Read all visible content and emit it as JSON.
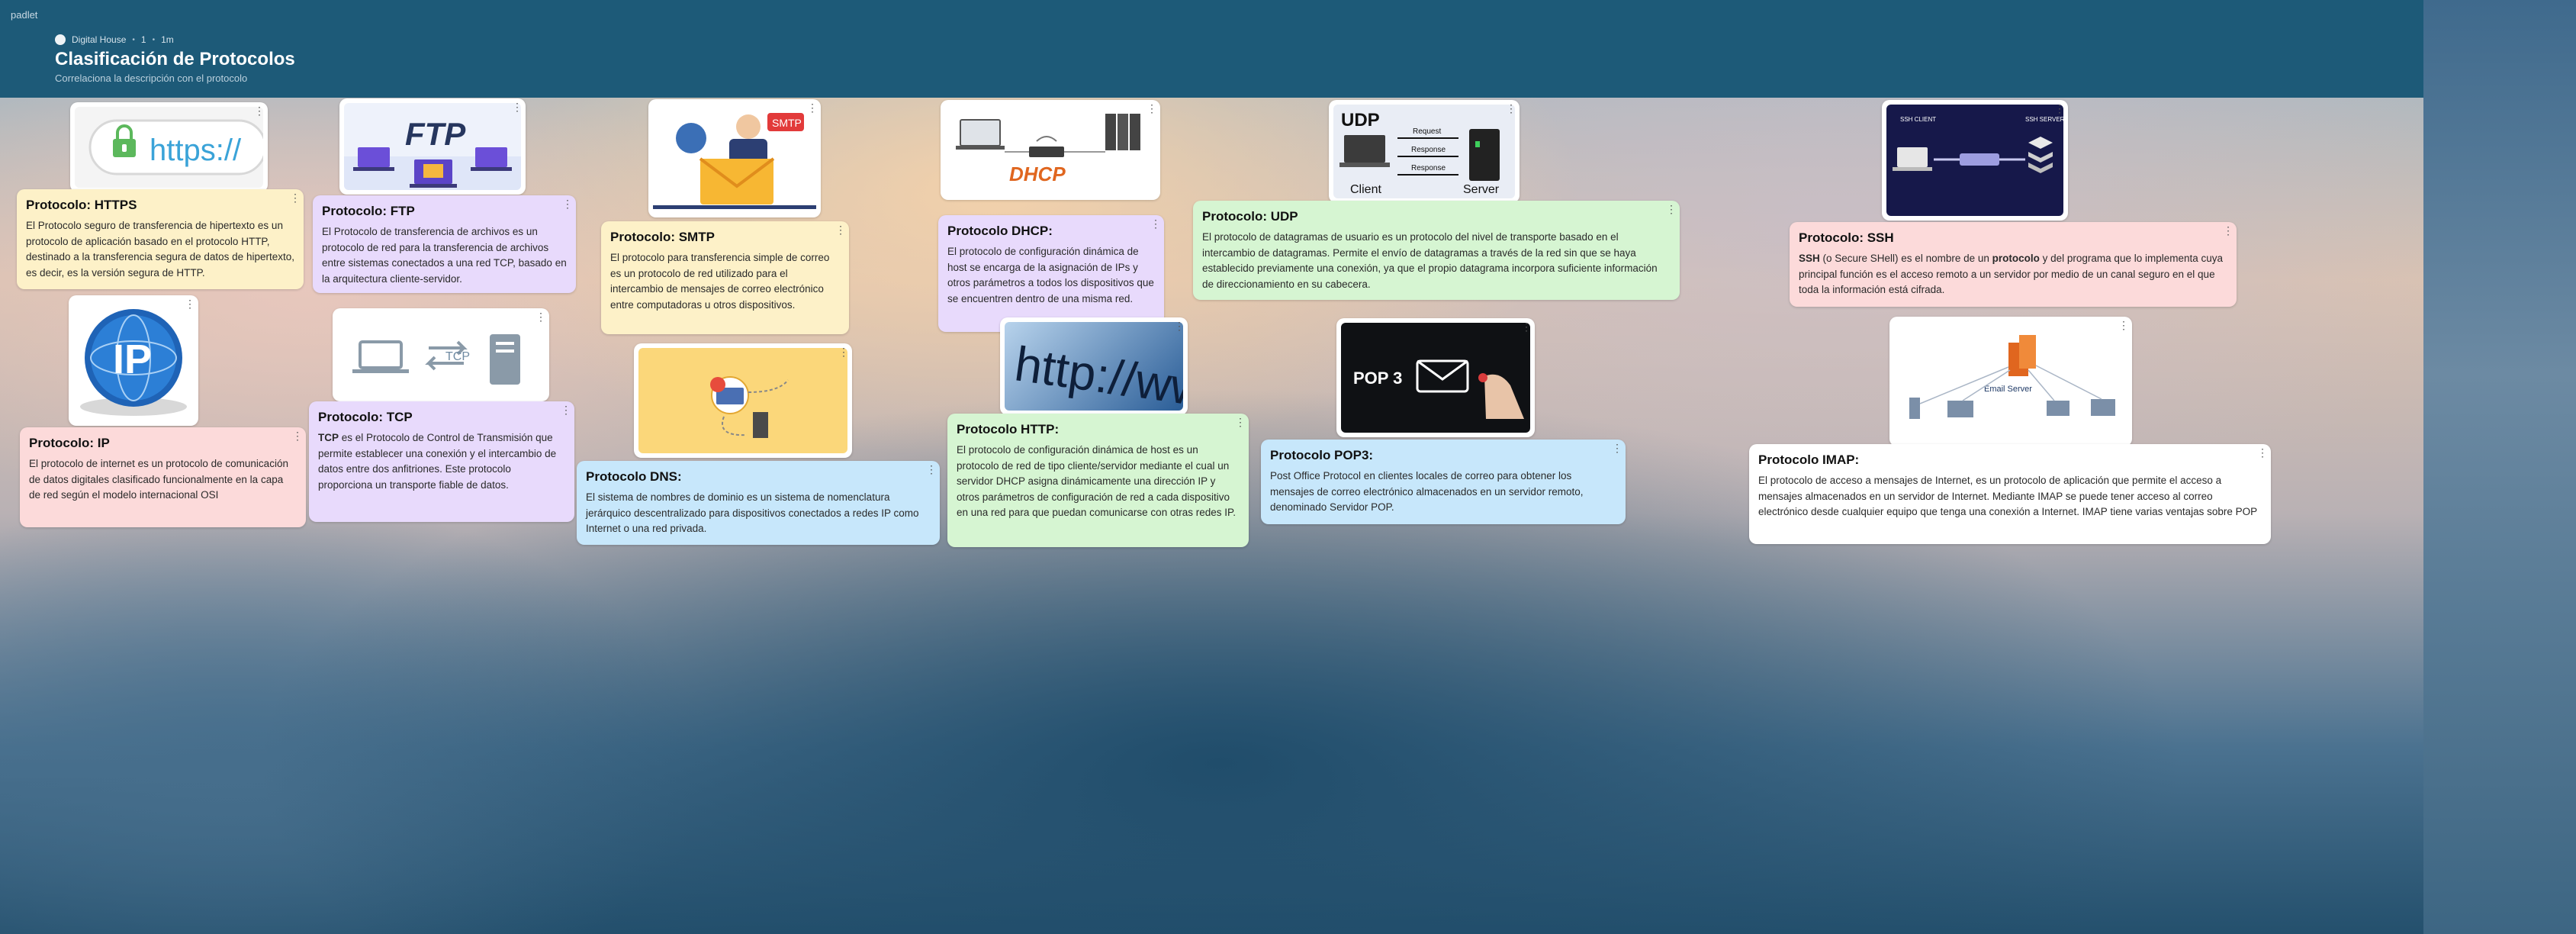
{
  "app": {
    "brand": "padlet"
  },
  "header": {
    "author": "Digital House",
    "count": "1",
    "time": "1m",
    "title": "Clasificación de Protocolos",
    "subtitle": "Correlaciona la descripción con el protocolo"
  },
  "colors": {
    "header": "#1d5a78",
    "yellow": "#fdf1c8",
    "violet": "#e8dafc",
    "pink": "#fcdada",
    "blue": "#c7e7fb",
    "green": "#d6f5d2"
  },
  "images": {
    "https": {
      "icon": "lock-icon",
      "text": "https://"
    },
    "ftp": {
      "icon": "laptops-icon",
      "text": "FTP"
    },
    "smtp": {
      "icon": "mail-envelope-icon",
      "text": "SMTP"
    },
    "dhcp": {
      "icon": "network-icon",
      "text": "DHCP"
    },
    "udp": {
      "text": "UDP",
      "request": "Request",
      "response1": "Response",
      "response2": "Response",
      "client": "Client",
      "server": "Server"
    },
    "ssh": {
      "client": "SSH CLIENT",
      "server": "SSH SERVER"
    },
    "ip": {
      "text": "IP"
    },
    "tcp": {
      "text": "TCP"
    },
    "dns": {
      "icon": "dns-icon"
    },
    "http": {
      "text": "http://ww"
    },
    "pop3": {
      "text": "POP 3"
    },
    "imap": {
      "text": "Email Server"
    }
  },
  "cards": {
    "https": {
      "title": "Protocolo: HTTPS",
      "body": "El Protocolo seguro de transferencia de hipertexto es un protocolo de aplicación basado en el protocolo HTTP, destinado a la transferencia segura de datos de hipertexto, es decir, es la versión segura de HTTP."
    },
    "ftp": {
      "title": "Protocolo: FTP",
      "body": "El Protocolo de transferencia de archivos es un protocolo de red para la transferencia de archivos entre sistemas conectados a una red TCP, basado en la arquitectura cliente-servidor."
    },
    "smtp": {
      "title": "Protocolo: SMTP",
      "body": "El protocolo para transferencia simple de correo es un protocolo de red utilizado para el intercambio de mensajes de correo electrónico entre computadoras u otros dispositivos."
    },
    "dhcp": {
      "title": "Protocolo DHCP:",
      "body": "El protocolo de configuración dinámica de host se encarga de la asignación de IPs y otros parámetros a todos los dispositivos que se encuentren dentro de una misma red."
    },
    "udp": {
      "title": "Protocolo: UDP",
      "body": "El protocolo de datagramas de usuario es un protocolo del nivel de transporte basado en el intercambio de datagramas. Permite el envío de datagramas a través de la red sin que se haya establecido previamente una conexión, ya que el propio datagrama incorpora suficiente información de direccionamiento en su cabecera."
    },
    "ssh": {
      "title": "Protocolo: SSH",
      "bold1": "SSH",
      "part1": " (o Secure SHell) es el nombre de un ",
      "bold2": "protocolo",
      "part2": " y del programa que lo implementa cuya principal función es el acceso remoto a un servidor por medio de un canal seguro en el que toda la información está cifrada."
    },
    "ip": {
      "title": "Protocolo: IP",
      "body": "El protocolo de internet es un protocolo de comunicación de datos digitales clasificado funcionalmente en la capa de red según el modelo internacional OSI"
    },
    "tcp": {
      "title": "Protocolo: TCP",
      "bold1": "TCP",
      "part1": " es el Protocolo de Control de Transmisión que permite establecer una conexión y el intercambio de datos entre dos anfitriones. Este protocolo proporciona un transporte fiable de datos."
    },
    "dns": {
      "title": "Protocolo DNS:",
      "body": "El sistema de nombres de dominio  es un sistema de nomenclatura jerárquico descentralizado para dispositivos conectados a redes IP como Internet o una red privada."
    },
    "http": {
      "title": "Protocolo HTTP:",
      "body": "El protocolo de configuración dinámica de host es un protocolo de red de tipo cliente/servidor mediante el cual un servidor DHCP asigna dinámicamente una dirección IP y otros parámetros de configuración de red a cada dispositivo en una red para que puedan comunicarse con otras redes IP."
    },
    "pop3": {
      "title": "Protocolo POP3:",
      "body": "Post Office Protocol en clientes locales de correo para obtener los mensajes de correo electrónico almacenados en un servidor remoto, denominado Servidor POP."
    },
    "imap": {
      "title": "Protocolo IMAP:",
      "body": "El protocolo de acceso a mensajes de Internet, es un protocolo de aplicación que permite el acceso a mensajes almacenados en un servidor de Internet. Mediante IMAP se puede tener acceso al correo electrónico desde cualquier equipo que tenga una conexión a Internet. IMAP tiene varias ventajas sobre POP"
    }
  }
}
